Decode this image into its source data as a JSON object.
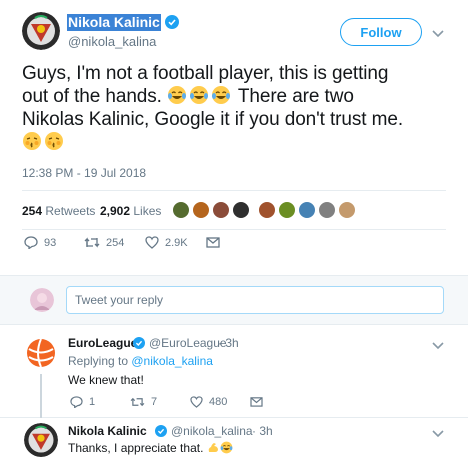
{
  "tweet": {
    "display_name": "Nikola Kalinic",
    "handle": "@nikola_kalina",
    "follow_label": "Follow",
    "text_line1": "Guys, I'm not a football player, this is getting",
    "text_line2_pre": "out of the hands.",
    "text_line2_post": "There are two",
    "text_line3": "Nikolas Kalinic, Google it if you don't trust me.",
    "timestamp": "12:38 PM - 19 Jul 2018",
    "retweets_count": "254",
    "retweets_label": "Retweets",
    "likes_count": "2,902",
    "likes_label": "Likes",
    "actions": {
      "replies": "93",
      "retweets": "254",
      "likes": "2.9K"
    }
  },
  "reply_box": {
    "placeholder": "Tweet your reply"
  },
  "replies": [
    {
      "name": "EuroLeague",
      "handle": "@EuroLeague",
      "time": "· 3h",
      "replying_prefix": "Replying to ",
      "replying_to": "@nikola_kalina",
      "text": "We knew that!",
      "replies": "1",
      "retweets": "7",
      "likes": "480"
    },
    {
      "name": "Nikola Kalinic",
      "handle": "@nikola_kalina",
      "time": "· 3h",
      "text": "Thanks, I appreciate that."
    }
  ],
  "colors": {
    "accent": "#1da1f2",
    "muted": "#657786",
    "border": "#e6ecf0",
    "euroleague_orange": "#f26522",
    "name_highlight": "#3b83d6"
  }
}
